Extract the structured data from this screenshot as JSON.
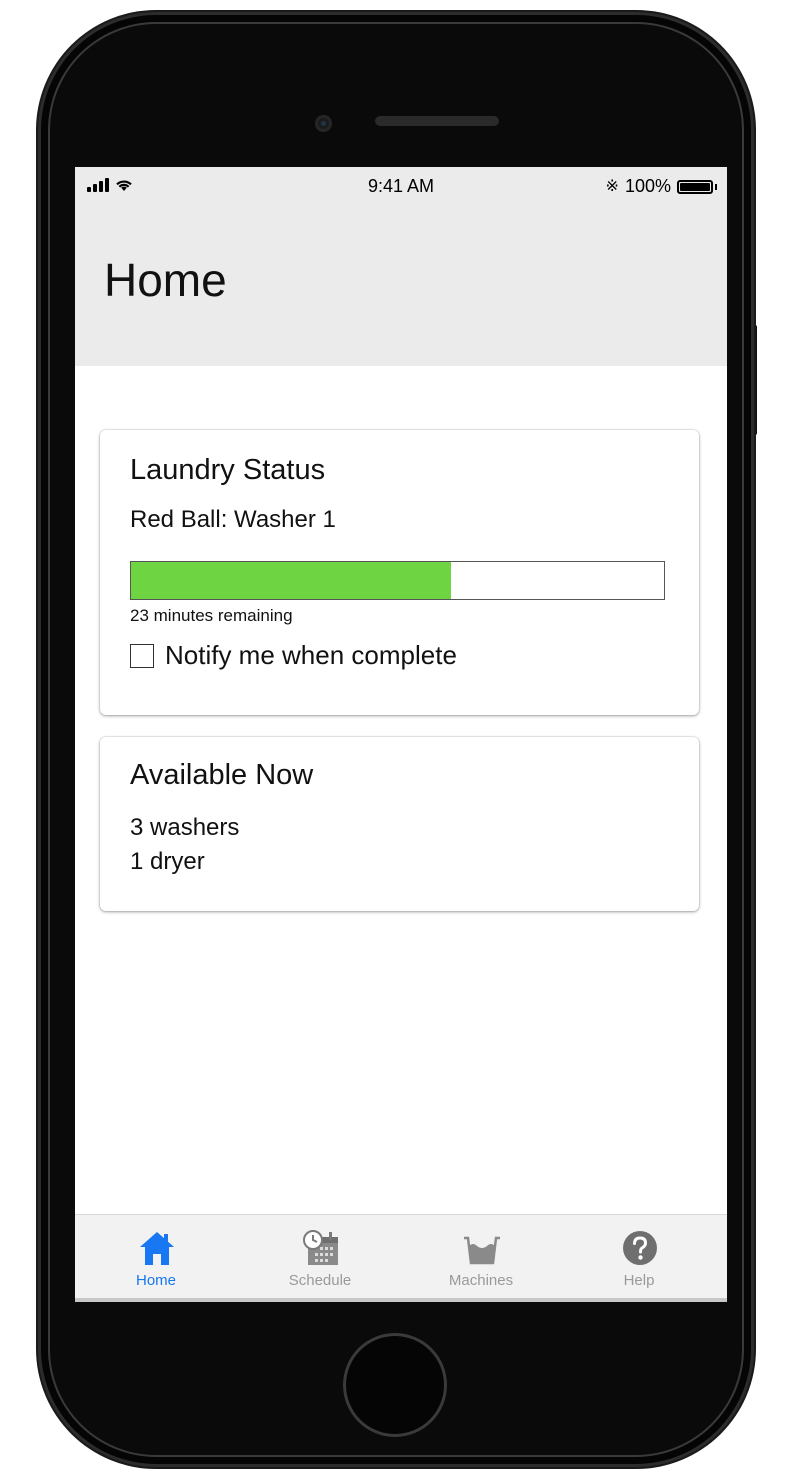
{
  "status_bar": {
    "time": "9:41 AM",
    "battery_percent": "100%",
    "battery_level": 1.0,
    "bluetooth_icon": "bluetooth-icon",
    "signal_icon": "signal-bars-icon",
    "wifi_icon": "wifi-icon"
  },
  "header": {
    "title": "Home"
  },
  "laundry_status": {
    "title": "Laundry Status",
    "machine": "Red Ball: Washer 1",
    "progress_fraction": 0.6,
    "remaining": "23 minutes remaining",
    "notify_label": "Notify me when complete",
    "notify_checked": false,
    "progress_color": "#6fd442"
  },
  "available_now": {
    "title": "Available Now",
    "washers": "3 washers",
    "dryers": "1 dryer"
  },
  "tab_bar": {
    "active_color": "#1877f2",
    "inactive_color": "#9a9a9a",
    "tabs": [
      {
        "label": "Home",
        "icon": "home-icon",
        "active": true
      },
      {
        "label": "Schedule",
        "icon": "calendar-clock-icon",
        "active": false
      },
      {
        "label": "Machines",
        "icon": "washtub-icon",
        "active": false
      },
      {
        "label": "Help",
        "icon": "question-circle-icon",
        "active": false
      }
    ]
  }
}
